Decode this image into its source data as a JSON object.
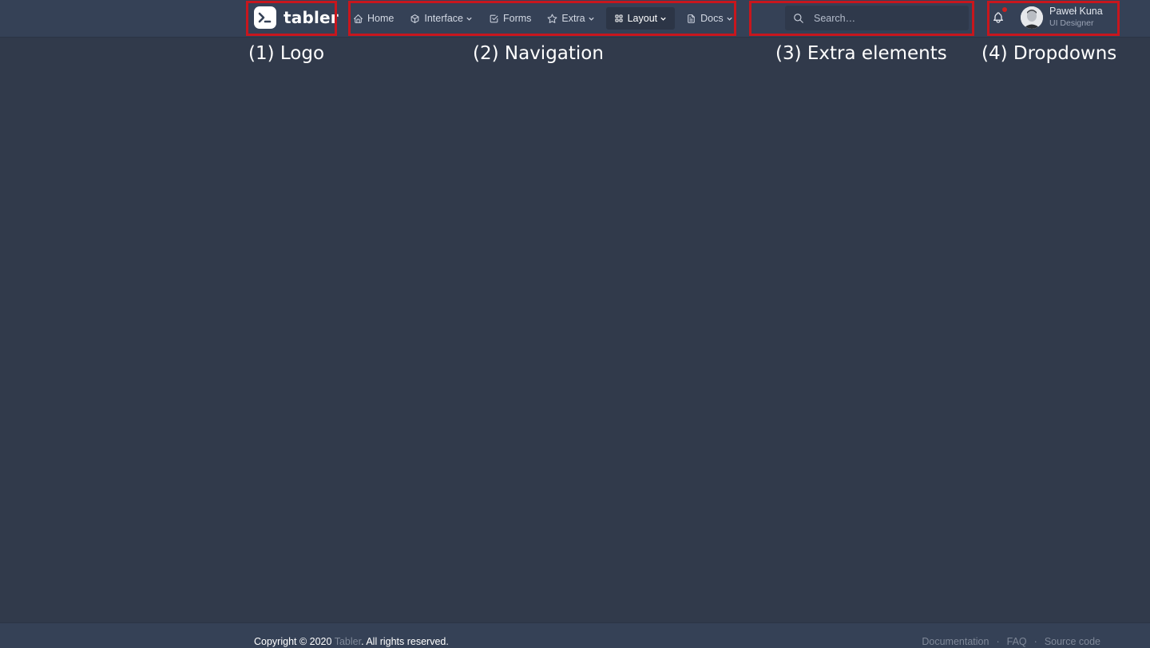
{
  "app": {
    "logo_text": "tabler"
  },
  "nav": {
    "items": [
      {
        "label": "Home",
        "icon": "home-icon"
      },
      {
        "label": "Interface",
        "icon": "package-icon",
        "dropdown": true
      },
      {
        "label": "Forms",
        "icon": "checkbox-icon"
      },
      {
        "label": "Extra",
        "icon": "star-icon",
        "dropdown": true
      },
      {
        "label": "Layout",
        "icon": "layout-grid-icon",
        "dropdown": true,
        "active": true
      },
      {
        "label": "Docs",
        "icon": "file-text-icon",
        "dropdown": true
      }
    ]
  },
  "search": {
    "placeholder": "Search…",
    "icon": "search-icon"
  },
  "notifications": {
    "icon": "bell-icon",
    "has_unread": true,
    "dot_color": "#cd201f"
  },
  "user": {
    "name": "Paweł Kuna",
    "role": "UI Designer"
  },
  "annotations": {
    "logo": "(1) Logo",
    "navigation": "(2) Navigation",
    "extra": "(3) Extra elements",
    "dropdowns": "(4) Dropdowns",
    "box_color": "#c8161d"
  },
  "footer": {
    "copyright_prefix": "Copyright © 2020 ",
    "brand_link": "Tabler",
    "copyright_suffix": ". All rights reserved.",
    "links": [
      "Documentation",
      "FAQ",
      "Source code"
    ],
    "separator": "·"
  }
}
